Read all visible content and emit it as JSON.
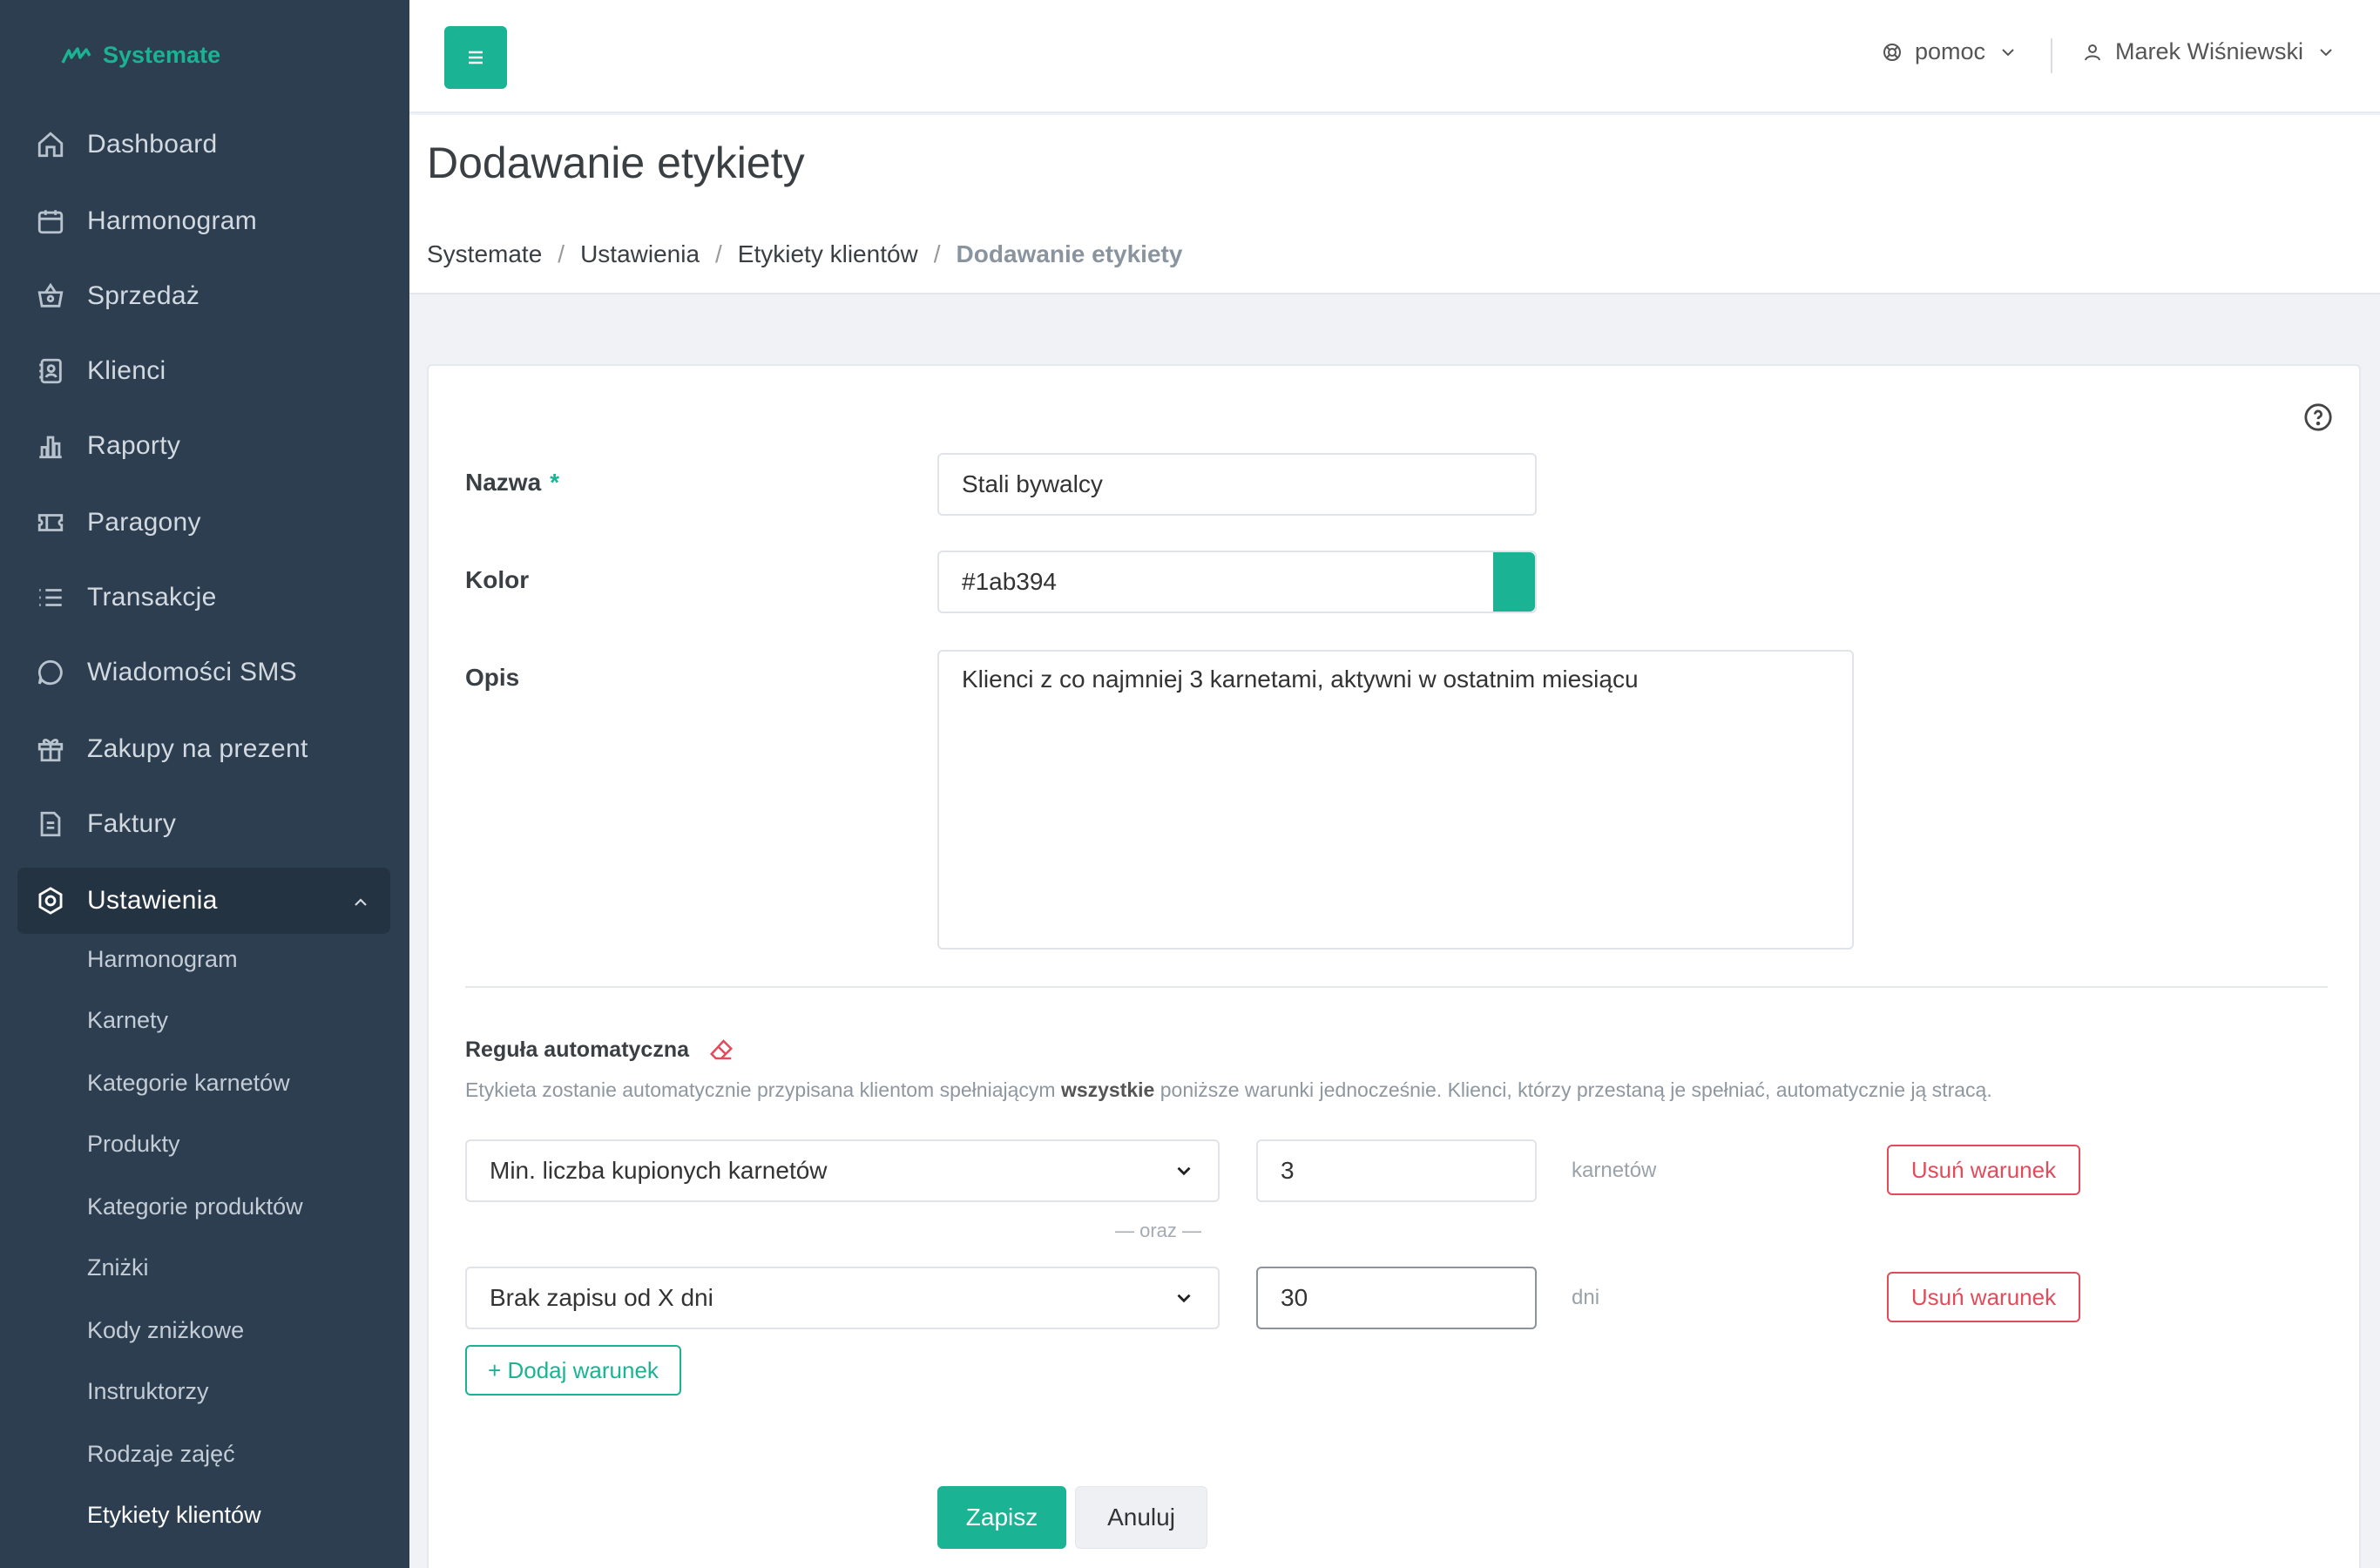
{
  "brand": {
    "name": "Systemate",
    "logo_icon": "systemate-logo-icon"
  },
  "colors": {
    "accent": "#1ab394",
    "sidebar_bg": "#2c3e50",
    "danger": "#e24b5b"
  },
  "sidebar": {
    "items": [
      {
        "label": "Dashboard",
        "icon": "home-icon"
      },
      {
        "label": "Harmonogram",
        "icon": "calendar-icon"
      },
      {
        "label": "Sprzedaż",
        "icon": "basket-icon"
      },
      {
        "label": "Klienci",
        "icon": "contacts-icon"
      },
      {
        "label": "Raporty",
        "icon": "bar-chart-icon"
      },
      {
        "label": "Paragony",
        "icon": "ticket-icon"
      },
      {
        "label": "Transakcje",
        "icon": "list-icon"
      },
      {
        "label": "Wiadomości SMS",
        "icon": "chat-icon"
      },
      {
        "label": "Zakupy na prezent",
        "icon": "gift-icon"
      },
      {
        "label": "Faktury",
        "icon": "document-icon"
      },
      {
        "label": "Ustawienia",
        "icon": "settings-icon",
        "expanded": true
      }
    ],
    "subitems": [
      "Harmonogram",
      "Karnety",
      "Kategorie karnetów",
      "Produkty",
      "Kategorie produktów",
      "Zniżki",
      "Kody zniżkowe",
      "Instruktorzy",
      "Rodzaje zajęć",
      "Etykiety klientów"
    ]
  },
  "topbar": {
    "help_label": "pomoc",
    "user_name": "Marek Wiśniewski"
  },
  "page": {
    "title": "Dodawanie etykiety",
    "breadcrumbs": [
      "Systemate",
      "Ustawienia",
      "Etykiety klientów",
      "Dodawanie etykiety"
    ]
  },
  "form": {
    "name_label": "Nazwa",
    "required_mark": "*",
    "name_value": "Stali bywalcy",
    "color_label": "Kolor",
    "color_value": "#1ab394",
    "desc_label": "Opis",
    "desc_value": "Klienci z co najmniej 3 karnetami, aktywni w ostatnim miesiącu",
    "rule_title": "Reguła automatyczna",
    "rule_desc_prefix": "Etykieta zostanie automatycznie przypisana klientom spełniającym ",
    "rule_desc_bold": "wszystkie",
    "rule_desc_suffix": " poniższe warunki jednocześnie. Klienci, którzy przestaną je spełniać, automatycznie ją stracą.",
    "conditions": [
      {
        "field": "Min. liczba kupionych karnetów",
        "value": "3",
        "unit": "karnetów",
        "remove_label": "Usuń warunek"
      },
      {
        "field": "Brak zapisu od X dni",
        "value": "30",
        "unit": "dni",
        "remove_label": "Usuń warunek"
      }
    ],
    "joiner": "— oraz —",
    "add_condition_label": "+ Dodaj warunek",
    "save_label": "Zapisz",
    "cancel_label": "Anuluj"
  }
}
